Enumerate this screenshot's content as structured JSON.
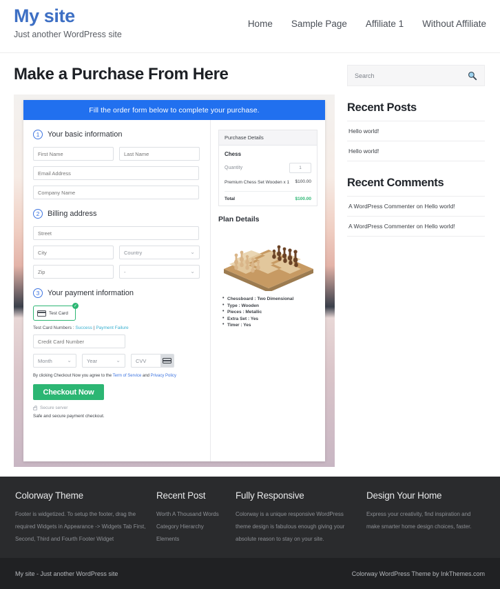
{
  "header": {
    "site_title": "My site",
    "tagline": "Just another WordPress site",
    "nav": [
      {
        "label": "Home"
      },
      {
        "label": "Sample Page"
      },
      {
        "label": "Affiliate 1"
      },
      {
        "label": "Without Affiliate"
      }
    ]
  },
  "main": {
    "page_title": "Make a Purchase From Here",
    "banner": "Fill the order form below to complete your purchase.",
    "steps": {
      "one": {
        "num": "1",
        "label": "Your basic information"
      },
      "two": {
        "num": "2",
        "label": "Billing address"
      },
      "three": {
        "num": "3",
        "label": "Your payment information"
      }
    },
    "fields": {
      "first_name": "First Name",
      "last_name": "Last Name",
      "email": "Email Address",
      "company": "Company Name",
      "street": "Street",
      "city": "City",
      "country": "Country",
      "zip": "Zip",
      "state": "-",
      "credit_card": "Credit Card Number",
      "month": "Month",
      "year": "Year",
      "cvv": "CVV"
    },
    "payment": {
      "test_card_label": "Test  Card",
      "badge": "✓",
      "test_numbers_prefix": "Test Card Numbers : ",
      "link_success": "Success",
      "separator": " | ",
      "link_failure": "Payment Failure",
      "terms_prefix": "By clicking Checkout Now you agree to the ",
      "terms_link1": "Term of Service",
      "terms_mid": " and ",
      "terms_link2": "Privacy Policy",
      "checkout_label": "Checkout Now",
      "secure_server": "Secure server",
      "safe_note": "Safe and secure payment checkout."
    },
    "purchase_details": {
      "heading": "Purchase Details",
      "item_name": "Chess",
      "qty_label": "Quantity",
      "qty_value": "1",
      "line_desc": "Premium Chess Set Wooden x 1",
      "line_price": "$100.00",
      "total_label": "Total",
      "total_value": "$100.00"
    },
    "plan_details": {
      "heading": "Plan Details",
      "image_alt": "chessboard-image",
      "features": [
        "Chessboard : Two Dimensional",
        "Type : Wooden",
        "Pieces : Metallic",
        "Extra Set : Yes",
        "Timer : Yes"
      ]
    }
  },
  "sidebar": {
    "search_placeholder": "Search",
    "recent_posts": {
      "title": "Recent Posts",
      "items": [
        "Hello world!",
        "Hello world!"
      ]
    },
    "recent_comments": {
      "title": "Recent Comments",
      "items": [
        "A WordPress Commenter on Hello world!",
        "A WordPress Commenter on Hello world!"
      ]
    }
  },
  "footer": {
    "columns": [
      {
        "title": "Colorway Theme",
        "text": "Footer is widgetized. To setup the footer, drag the required Widgets in Appearance -> Widgets Tab First, Second, Third and Fourth Footer Widget"
      },
      {
        "title": "Recent Post",
        "links": [
          "Worth A Thousand Words",
          "Category Hierarchy",
          "Elements"
        ]
      },
      {
        "title": "Fully Responsive",
        "text": "Colorway is a unique responsive WordPress theme design is fabulous enough giving your absolute reason to stay on your site."
      },
      {
        "title": "Design Your Home",
        "text": "Express your creativity, find inspiration and make smarter home design choices, faster."
      }
    ],
    "bottom_left": "My site - Just another WordPress site",
    "bottom_right": "Colorway WordPress Theme by InkThemes.com"
  },
  "colors": {
    "brand_blue": "#3d6fc4",
    "banner_blue": "#2170ef",
    "accent_green": "#2cb673",
    "link_cyan": "#39b0d0",
    "footer_dark": "#2a2b2d",
    "footer_bar": "#202123"
  }
}
